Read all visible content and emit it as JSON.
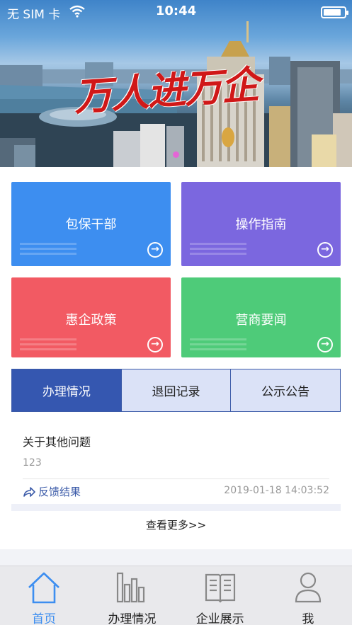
{
  "status_bar": {
    "carrier": "无 SIM 卡",
    "time": "10:44",
    "battery_level": 0.85
  },
  "banner": {
    "title": "万人进万企",
    "slide_indicator_color": "#e466d6"
  },
  "tiles": [
    {
      "label": "包保干部",
      "color": "#3d8ef0"
    },
    {
      "label": "操作指南",
      "color": "#7b67df"
    },
    {
      "label": "惠企政策",
      "color": "#f25a63"
    },
    {
      "label": "营商要闻",
      "color": "#4ecb79"
    }
  ],
  "tabs": [
    {
      "label": "办理情况",
      "active": true
    },
    {
      "label": "退回记录",
      "active": false
    },
    {
      "label": "公示公告",
      "active": false
    }
  ],
  "record": {
    "title": "关于其他问题",
    "body": "123",
    "feedback_label": "反馈结果",
    "timestamp": "2019-01-18 14:03:52"
  },
  "more_label": "查看更多>>",
  "tab_bar": {
    "items": [
      {
        "label": "首页",
        "icon": "home-icon",
        "active": true
      },
      {
        "label": "办理情况",
        "icon": "chart-icon",
        "active": false
      },
      {
        "label": "企业展示",
        "icon": "book-icon",
        "active": false
      },
      {
        "label": "我",
        "icon": "person-icon",
        "active": false
      }
    ],
    "active_color": "#3d8ef0"
  }
}
